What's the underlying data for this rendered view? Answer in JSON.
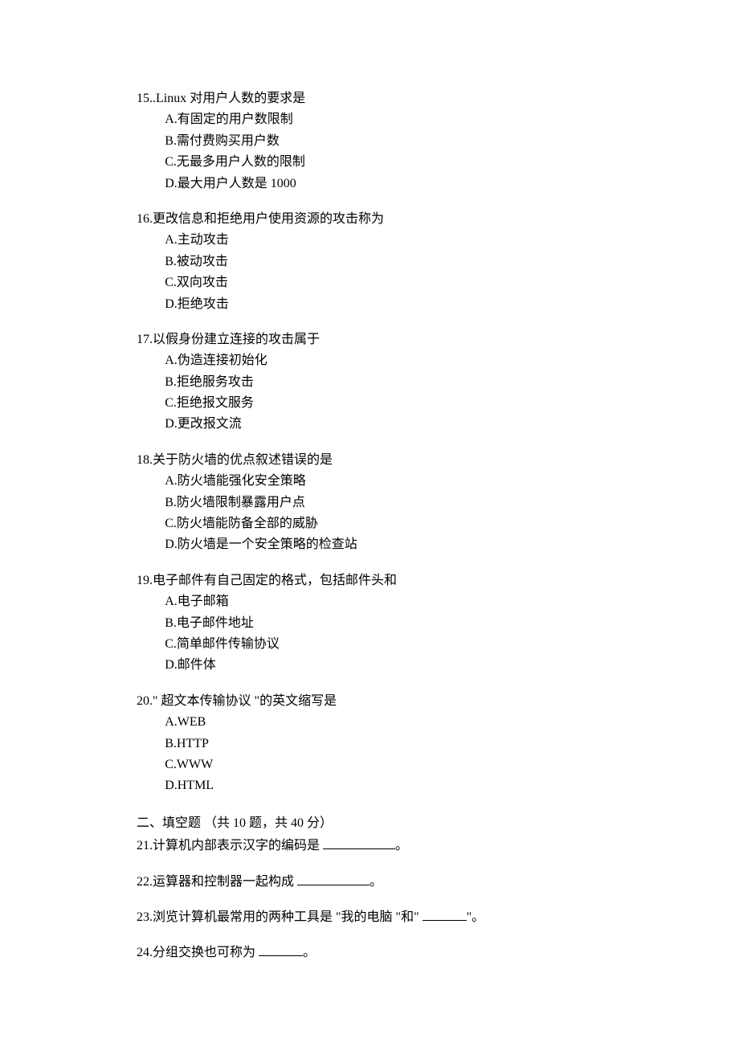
{
  "questions": [
    {
      "number": "15.",
      "stem": ".Linux 对用户人数的要求是",
      "options": [
        "A.有固定的用户数限制",
        "B.需付费购买用户数",
        "C.无最多用户人数的限制",
        "D.最大用户人数是 1000"
      ]
    },
    {
      "number": "16.",
      "stem": "更改信息和拒绝用户使用资源的攻击称为",
      "options": [
        "A.主动攻击",
        "B.被动攻击",
        "C.双向攻击",
        "D.拒绝攻击"
      ]
    },
    {
      "number": "17.",
      "stem": "以假身份建立连接的攻击属于",
      "options": [
        "A.伪造连接初始化",
        "B.拒绝服务攻击",
        "C.拒绝报文服务",
        "D.更改报文流"
      ]
    },
    {
      "number": "18.",
      "stem": "关于防火墙的优点叙述错误的是",
      "options": [
        "A.防火墙能强化安全策略",
        "B.防火墙限制暴露用户点",
        "C.防火墙能防备全部的威胁",
        "D.防火墙是一个安全策略的检查站"
      ]
    },
    {
      "number": "19.",
      "stem": "电子邮件有自己固定的格式，包括邮件头和",
      "options": [
        "A.电子邮箱",
        "B.电子邮件地址",
        "C.简单邮件传输协议",
        "D.邮件体"
      ]
    },
    {
      "number": "20.",
      "stem": "\" 超文本传输协议 \"的英文缩写是",
      "options": [
        "A.WEB",
        "B.HTTP",
        "C.WWW",
        "D.HTML"
      ]
    }
  ],
  "section2": {
    "title": "二、填空题 （共 10 题，共 40 分）",
    "items": [
      {
        "number": "21.",
        "pre": "计算机内部表示汉字的编码是 ",
        "post": "。",
        "blank": "long"
      },
      {
        "number": "22.",
        "pre": "运算器和控制器一起构成 ",
        "post": "。",
        "blank": "long"
      },
      {
        "number": "23.",
        "pre": "浏览计算机最常用的两种工具是 \"我的电脑 \"和\" ",
        "post": "\"。",
        "blank": "short"
      },
      {
        "number": "24.",
        "pre": "分组交换也可称为 ",
        "post": "。",
        "blank": "short"
      }
    ]
  }
}
